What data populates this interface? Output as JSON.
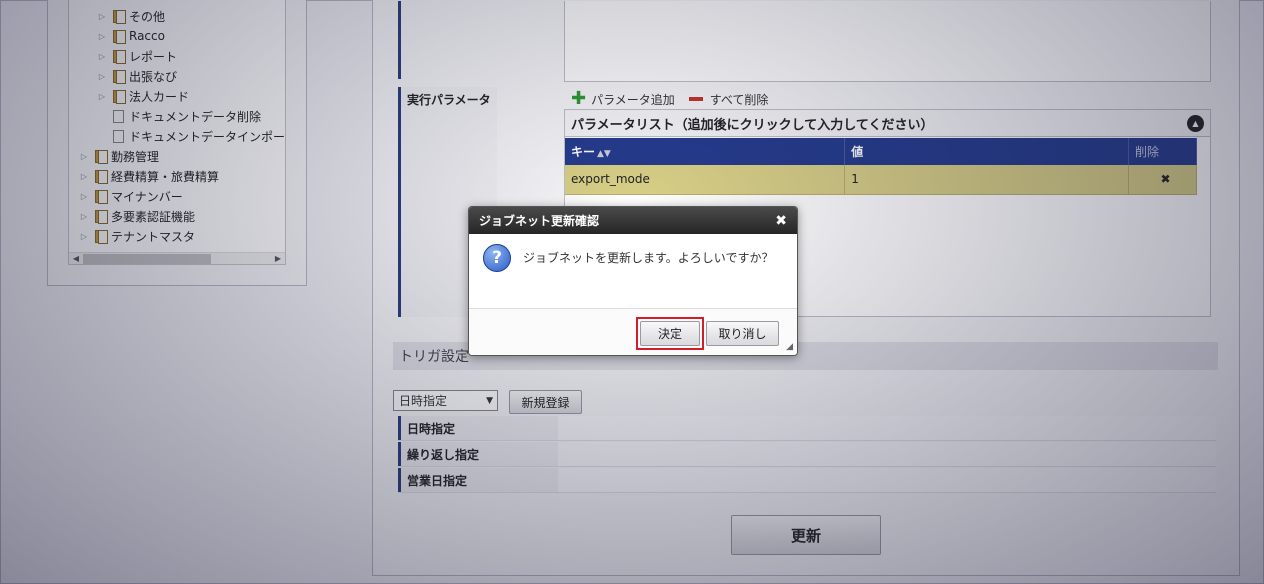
{
  "tree": {
    "items": [
      {
        "label": "その他",
        "type": "folder",
        "expand": true,
        "indent": 1
      },
      {
        "label": "Racco",
        "type": "folder",
        "expand": true,
        "indent": 1
      },
      {
        "label": "レポート",
        "type": "folder",
        "expand": true,
        "indent": 1
      },
      {
        "label": "出張なび",
        "type": "folder",
        "expand": true,
        "indent": 1
      },
      {
        "label": "法人カード",
        "type": "folder",
        "expand": true,
        "indent": 1
      },
      {
        "label": "ドキュメントデータ削除",
        "type": "doc",
        "expand": false,
        "indent": 1
      },
      {
        "label": "ドキュメントデータインポー",
        "type": "doc",
        "expand": false,
        "indent": 1
      },
      {
        "label": "勤務管理",
        "type": "folder",
        "expand": true,
        "indent": 0
      },
      {
        "label": "経費精算・旅費精算",
        "type": "folder",
        "expand": true,
        "indent": 0
      },
      {
        "label": "マイナンバー",
        "type": "folder",
        "expand": true,
        "indent": 0
      },
      {
        "label": "多要素認証機能",
        "type": "folder",
        "expand": true,
        "indent": 0
      },
      {
        "label": "テナントマスタ",
        "type": "folder",
        "expand": true,
        "indent": 0
      }
    ]
  },
  "params": {
    "label": "実行パラメータ",
    "add_label": "パラメータ追加",
    "delete_all_label": "すべて削除",
    "list_title": "パラメータリスト（追加後にクリックして入力してください）",
    "columns": {
      "key": "キー",
      "value": "値",
      "delete": "削除"
    },
    "rows": [
      {
        "key": "export_mode",
        "value": "1"
      }
    ]
  },
  "trigger": {
    "section_title": "トリガ設定",
    "select_value": "日時指定",
    "new_button": "新規登録",
    "rows": [
      "日時指定",
      "繰り返し指定",
      "営業日指定"
    ]
  },
  "update_button": "更新",
  "dialog": {
    "title": "ジョブネット更新確認",
    "message": "ジョブネットを更新します。よろしいですか？",
    "ok_label": "決定",
    "cancel_label": "取り消し"
  }
}
